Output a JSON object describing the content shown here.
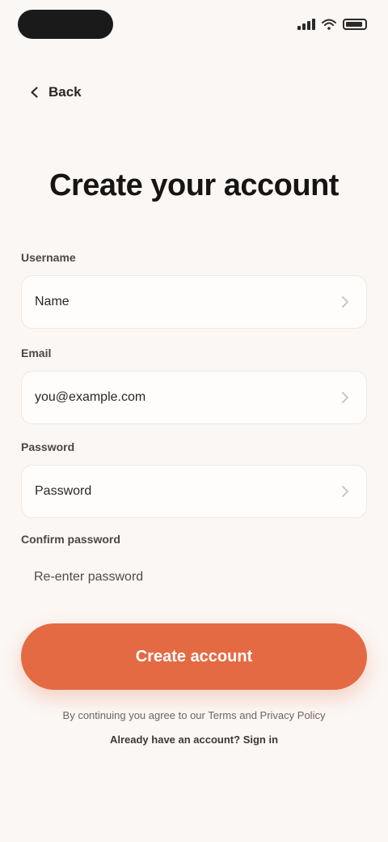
{
  "status_bar": {
    "left_pill": "",
    "right": ""
  },
  "nav": {
    "back_label": "Back"
  },
  "page": {
    "title": "Create your account"
  },
  "form": {
    "fields": [
      {
        "label": "Username",
        "value": "Name"
      },
      {
        "label": "Email",
        "value": "you@example.com"
      },
      {
        "label": "Password",
        "value": "Password"
      },
      {
        "label": "Confirm password",
        "value": "Re-enter password"
      }
    ]
  },
  "cta": {
    "label": "Create account"
  },
  "legal": {
    "line1": "By continuing you agree to our Terms and Privacy Policy",
    "line2": "Already have an account? Sign in"
  },
  "colors": {
    "background": "#fbf7f4",
    "accent": "#e46a43",
    "field_bg": "#fffdfb",
    "text_primary": "#161514"
  },
  "icons": {
    "back": "chevron-left-icon",
    "field_trailing": "chevron-right-icon",
    "signal": "signal-icon",
    "wifi": "wifi-icon",
    "battery": "battery-icon"
  }
}
